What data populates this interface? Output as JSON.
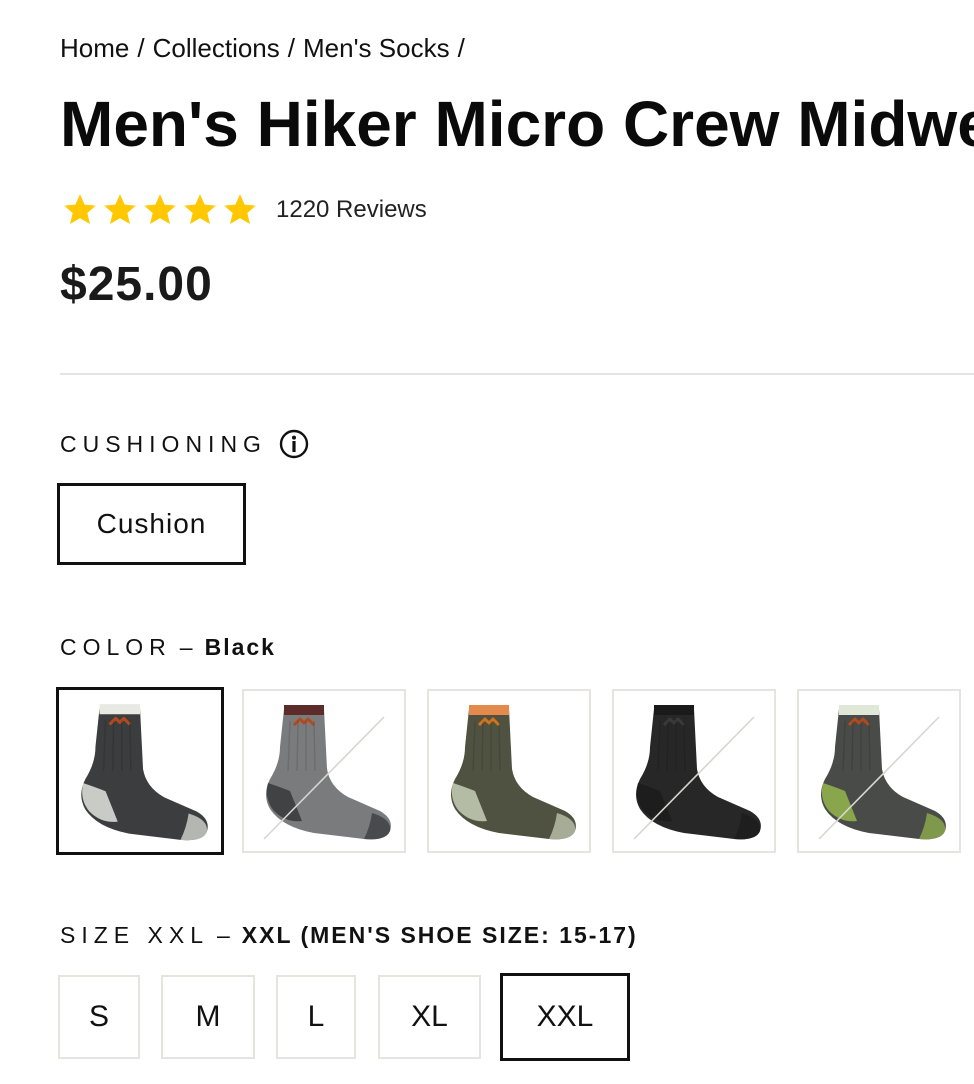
{
  "breadcrumb": {
    "items": [
      "Home",
      "Collections",
      "Men's Socks"
    ],
    "separator": "/"
  },
  "product": {
    "title": "Men's Hiker Micro Crew Midweight Hiking Sock",
    "rating": 5,
    "rating_max": 5,
    "reviews_label": "1220 Reviews",
    "price": "$25.00",
    "star_color": "#ffc800"
  },
  "cushioning": {
    "label": "CUSHIONING",
    "info_icon": "info-icon",
    "options": [
      "Cushion"
    ],
    "selected": "Cushion"
  },
  "color": {
    "label": "COLOR",
    "dash": "–",
    "selected": "Black",
    "swatches": [
      {
        "name": "Black",
        "available": true,
        "selected": true,
        "body": "#3c3d3e",
        "heel": "#c9cbc7",
        "cuff": "#e9e9e4",
        "logo": "#b34a1f"
      },
      {
        "name": "Gray",
        "available": false,
        "selected": false,
        "body": "#6f7072",
        "heel": "#414244",
        "cuff": "#5c2c2a",
        "logo": "#b34a1f"
      },
      {
        "name": "Olive",
        "available": true,
        "selected": false,
        "body": "#4f5240",
        "heel": "#b5bca5",
        "cuff": "#e48a4c",
        "logo": "#d2741b"
      },
      {
        "name": "Jet Black",
        "available": false,
        "selected": false,
        "body": "#151515",
        "heel": "#1d1d1d",
        "cuff": "#1a1a1a",
        "logo": "#3a3a3a"
      },
      {
        "name": "Green",
        "available": false,
        "selected": false,
        "body": "#3a3c38",
        "heel": "#8aa64d",
        "cuff": "#dfe7d7",
        "logo": "#b34a1f"
      }
    ]
  },
  "size": {
    "label": "SIZE XXL",
    "dash": "–",
    "selected_desc": "XXL (MEN'S SHOE SIZE: 15-17)",
    "options": [
      "S",
      "M",
      "L",
      "XL",
      "XXL"
    ],
    "selected": "XXL"
  }
}
